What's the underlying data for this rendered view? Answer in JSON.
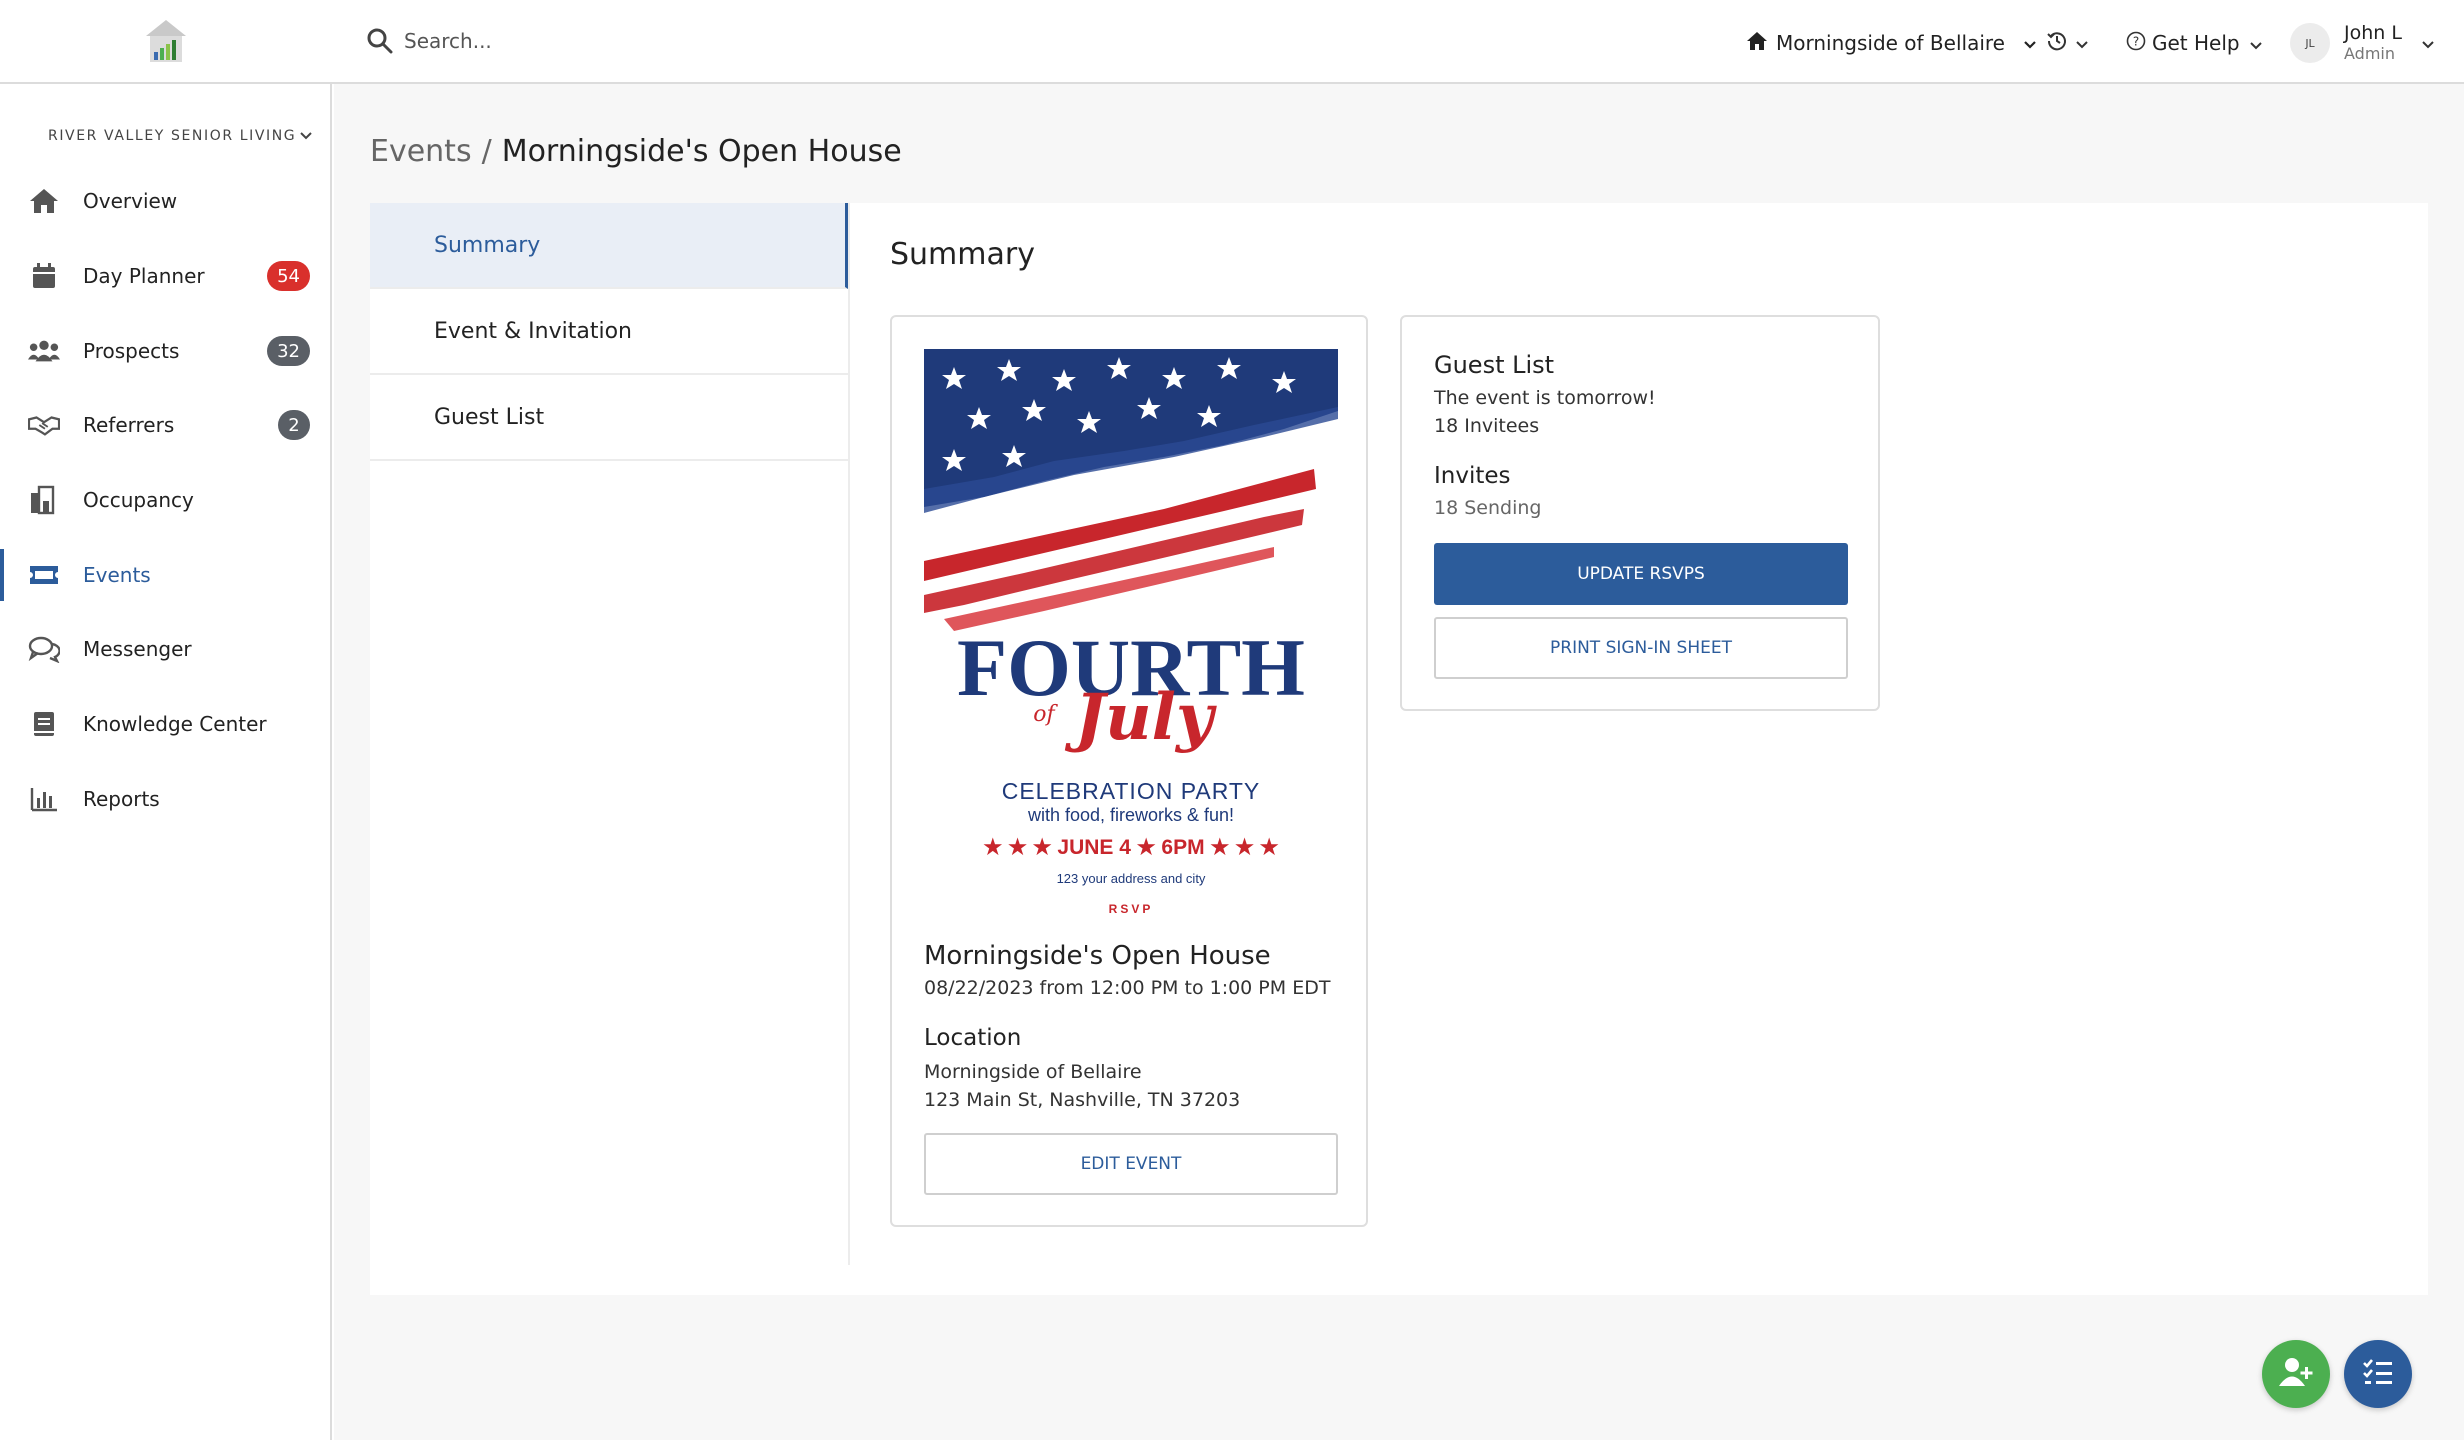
{
  "header": {
    "logo_icon": "senior-living-house-icon",
    "search_placeholder": "Search...",
    "community": "Morningside of Bellaire",
    "help_label": "Get Help",
    "user": {
      "initials": "JL",
      "name": "John L",
      "role": "Admin"
    }
  },
  "sidebar": {
    "organization": "RIVER VALLEY SENIOR LIVING",
    "items": [
      {
        "label": "Overview",
        "icon": "home-icon"
      },
      {
        "label": "Day Planner",
        "icon": "calendar-icon",
        "badge": "54",
        "badge_color": "#d9302c"
      },
      {
        "label": "Prospects",
        "icon": "people-icon",
        "badge": "32",
        "badge_color": "#5a5f66"
      },
      {
        "label": "Referrers",
        "icon": "handshake-icon",
        "badge": "2",
        "badge_color": "#5a5f66"
      },
      {
        "label": "Occupancy",
        "icon": "building-icon"
      },
      {
        "label": "Events",
        "icon": "ticket-icon",
        "active": true
      },
      {
        "label": "Messenger",
        "icon": "chat-icon"
      },
      {
        "label": "Knowledge Center",
        "icon": "book-icon"
      },
      {
        "label": "Reports",
        "icon": "bar-chart-icon"
      }
    ]
  },
  "breadcrumb": {
    "parent": "Events",
    "separator": "/",
    "current": "Morningside's Open House"
  },
  "subnav": {
    "items": [
      {
        "label": "Summary",
        "active": true
      },
      {
        "label": "Event & Invitation"
      },
      {
        "label": "Guest List"
      }
    ]
  },
  "summary": {
    "title": "Summary",
    "flyer": {
      "title_line1": "FOURTH",
      "title_of": "of",
      "title_script": "July",
      "headline": "CELEBRATION PARTY",
      "tagline": "with food, fireworks & fun!",
      "date_time": "★ ★ ★ JUNE 4 ★ 6PM ★ ★ ★",
      "address": "123 your address and city",
      "rsvp": "RSVP"
    },
    "event": {
      "name": "Morningside's Open House",
      "when": "08/22/2023 from 12:00 PM to 1:00 PM EDT",
      "location_heading": "Location",
      "location_name": "Morningside of Bellaire",
      "location_address": "123 Main St, Nashville, TN 37203",
      "edit_label": "EDIT EVENT"
    },
    "guest_list": {
      "heading": "Guest List",
      "status": "The event is tomorrow!",
      "invitee_count": "18 Invitees",
      "invites_heading": "Invites",
      "sending": "18 Sending",
      "update_label": "UPDATE RSVPS",
      "print_label": "PRINT SIGN-IN SHEET"
    }
  },
  "fabs": [
    {
      "icon": "add-person-icon",
      "color": "#4caf50"
    },
    {
      "icon": "task-list-icon",
      "color": "#2c5c9b"
    }
  ],
  "colors": {
    "brand": "#2c5c9b",
    "flag_red": "#c8262c",
    "flag_blue": "#1f3a7a"
  }
}
